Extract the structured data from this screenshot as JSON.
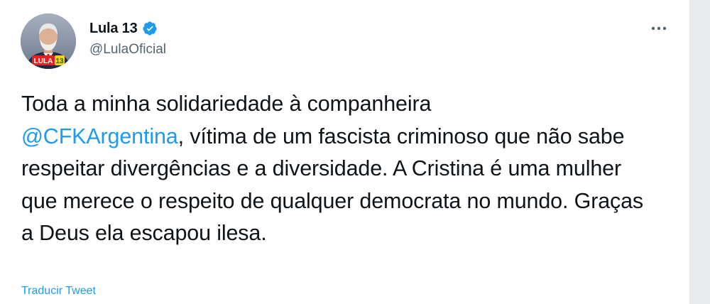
{
  "tweet": {
    "author": {
      "display_name": "Lula 13",
      "handle": "@LulaOficial",
      "verified": true,
      "avatar_badge_text": "LULA",
      "avatar_badge_number": "13"
    },
    "text": {
      "part_before_mention": "Toda a minha solidariedade à companheira",
      "mention": "@CFKArgentina",
      "part_after_mention": ", vítima de um fascista criminoso que não sabe respeitar divergências e a diversidade. A Cristina é uma mulher que merece o respeito de qualquer democrata no mundo. Graças a Deus ela escapou ilesa."
    },
    "translate_label": "Traducir Tweet",
    "more_icon": "more-horizontal-icon"
  },
  "colors": {
    "accent": "#1d9bf0",
    "text": "#0f1419",
    "secondary_text": "#536471",
    "verified": "#1d9bf0",
    "badge_red": "#e4211c",
    "badge_yellow": "#f6d21a"
  }
}
